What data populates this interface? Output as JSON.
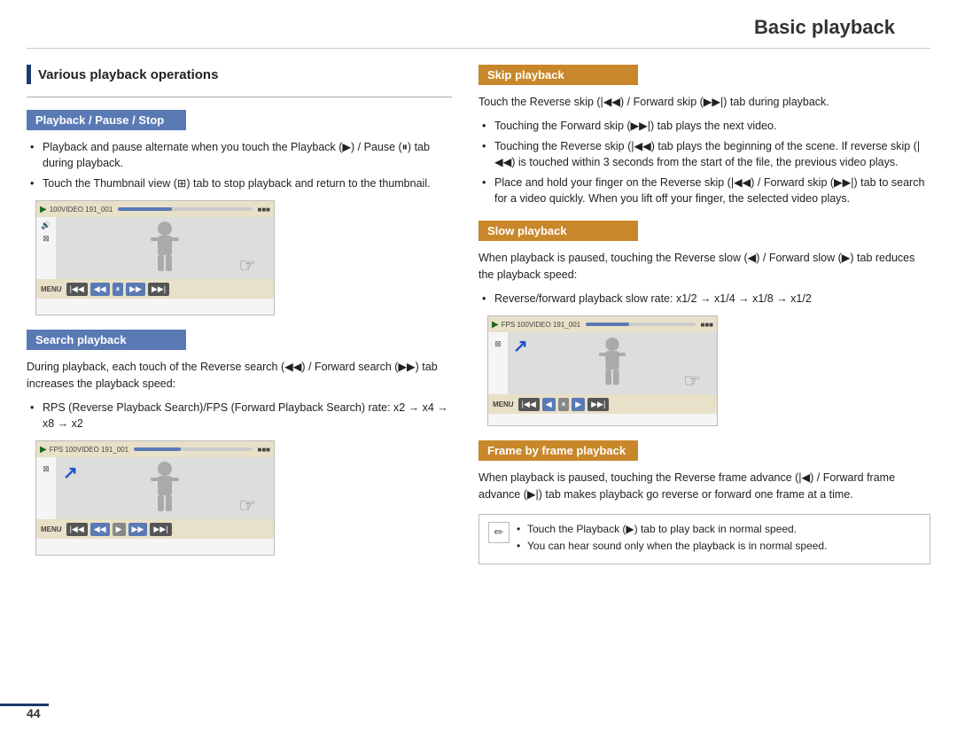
{
  "page": {
    "title": "Basic playback",
    "page_number": "44"
  },
  "left": {
    "section_title": "Various playback operations",
    "subsection1": {
      "header": "Playback / Pause / Stop",
      "bullets": [
        "Playback and pause alternate when you touch the Playback (▶) / Pause (⏸) tab during playback.",
        "Touch the Thumbnail view (⊞) tab to stop playback and return to the thumbnail."
      ]
    },
    "subsection2": {
      "header": "Search playback",
      "desc": "During playback, each touch of the Reverse search (◀◀) / Forward search (▶▶) tab increases the playback speed:",
      "bullets": [
        "RPS (Reverse Playback Search)/FPS (Forward Playback Search) rate: x2 → x4 → x8 → x2"
      ]
    }
  },
  "right": {
    "subsection1": {
      "header": "Skip playback",
      "desc": "Touch the Reverse skip (|◀◀) / Forward skip (▶▶|) tab during playback.",
      "bullets": [
        "Touching the Forward skip (▶▶|) tab plays the next video.",
        "Touching the Reverse skip (|◀◀) tab plays the beginning of the scene. If reverse skip (|◀◀) is touched within 3 seconds from the start of the file, the previous video plays.",
        "Place and hold your finger on the Reverse skip (|◀◀) / Forward skip (▶▶|) tab to search for a video quickly. When you lift off your finger, the selected video plays."
      ]
    },
    "subsection2": {
      "header": "Slow playback",
      "desc": "When playback is paused, touching the Reverse slow (◀) / Forward slow (▶) tab reduces the playback speed:",
      "bullets": [
        "Reverse/forward playback slow rate: x1/2 → x1/4 → x1/8 → x1/2"
      ]
    },
    "subsection3": {
      "header": "Frame by frame playback",
      "desc": "When playback is paused, touching the Reverse frame advance (|◀) / Forward frame advance (▶|) tab makes playback go reverse or forward one frame at a time.",
      "notes": [
        "Touch the Playback (▶) tab to play back in normal speed.",
        "You can hear sound only when the playback is in normal speed."
      ]
    }
  }
}
